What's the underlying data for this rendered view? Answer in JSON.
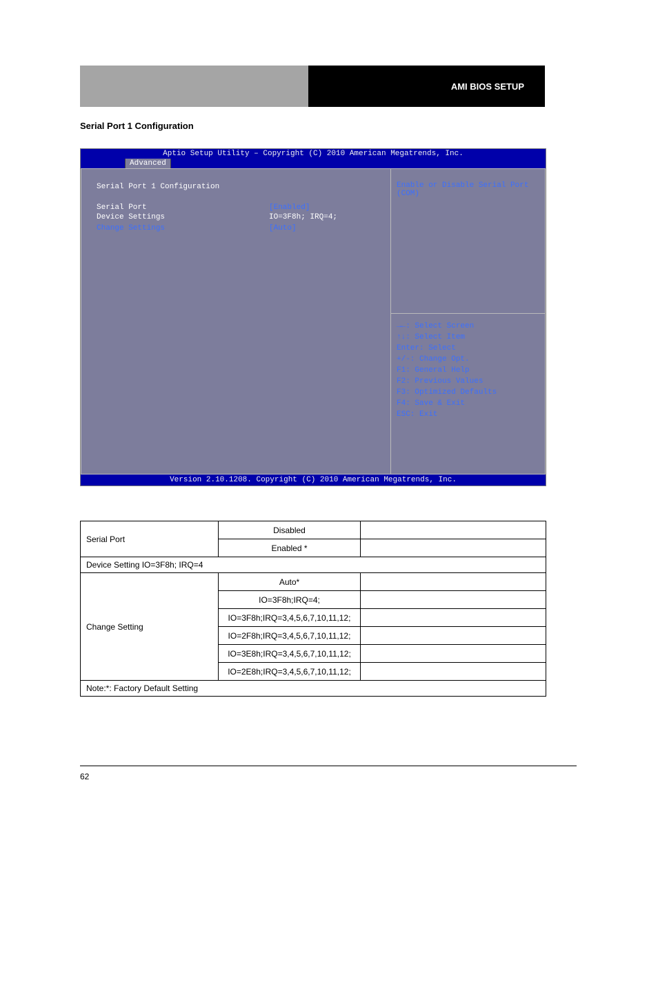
{
  "header": {
    "right_text": "AMI BIOS SETUP"
  },
  "section_title": "Serial Port 1 Configuration",
  "bios": {
    "title": "Aptio Setup Utility – Copyright (C) 2010 American Megatrends, Inc.",
    "tab": "Advanced",
    "heading": "Serial Port 1 Configuration",
    "rows": [
      {
        "label": "Serial Port",
        "value": "[Enabled]",
        "value_blue": true
      },
      {
        "label": "Device Settings",
        "value": "IO=3F8h; IRQ=4;",
        "value_blue": false
      },
      {
        "label": "",
        "value": "",
        "value_blue": false
      },
      {
        "label": "Change Settings",
        "value": "[Auto]",
        "label_blue": true,
        "value_blue": true
      }
    ],
    "help": {
      "line1": "Enable or Disable Serial Port",
      "line2": "(COM)"
    },
    "nav": [
      "→←: Select Screen",
      "↑↓: Select Item",
      "Enter: Select",
      "+/-: Change Opt.",
      "F1: General Help",
      "F2: Previous Values",
      "F3: Optimized Defaults",
      "F4: Save & Exit",
      "ESC: Exit"
    ],
    "footer": "Version 2.10.1208. Copyright (C) 2010 American Megatrends, Inc."
  },
  "table": {
    "row1": {
      "label": "Serial Port",
      "opt1": "Disabled",
      "opt2": "Enabled *"
    },
    "span1": "Device Setting                                           IO=3F8h; IRQ=4",
    "row2label": "Change Setting",
    "row2opts": [
      "Auto*",
      "IO=3F8h;IRQ=4;",
      "IO=3F8h;IRQ=3,4,5,6,7,10,11,12;",
      "IO=2F8h;IRQ=3,4,5,6,7,10,11,12;",
      "IO=3E8h;IRQ=3,4,5,6,7,10,11,12;",
      "IO=2E8h;IRQ=3,4,5,6,7,10,11,12;"
    ],
    "caption": "Note:*: Factory Default Setting"
  },
  "page_num": "62"
}
